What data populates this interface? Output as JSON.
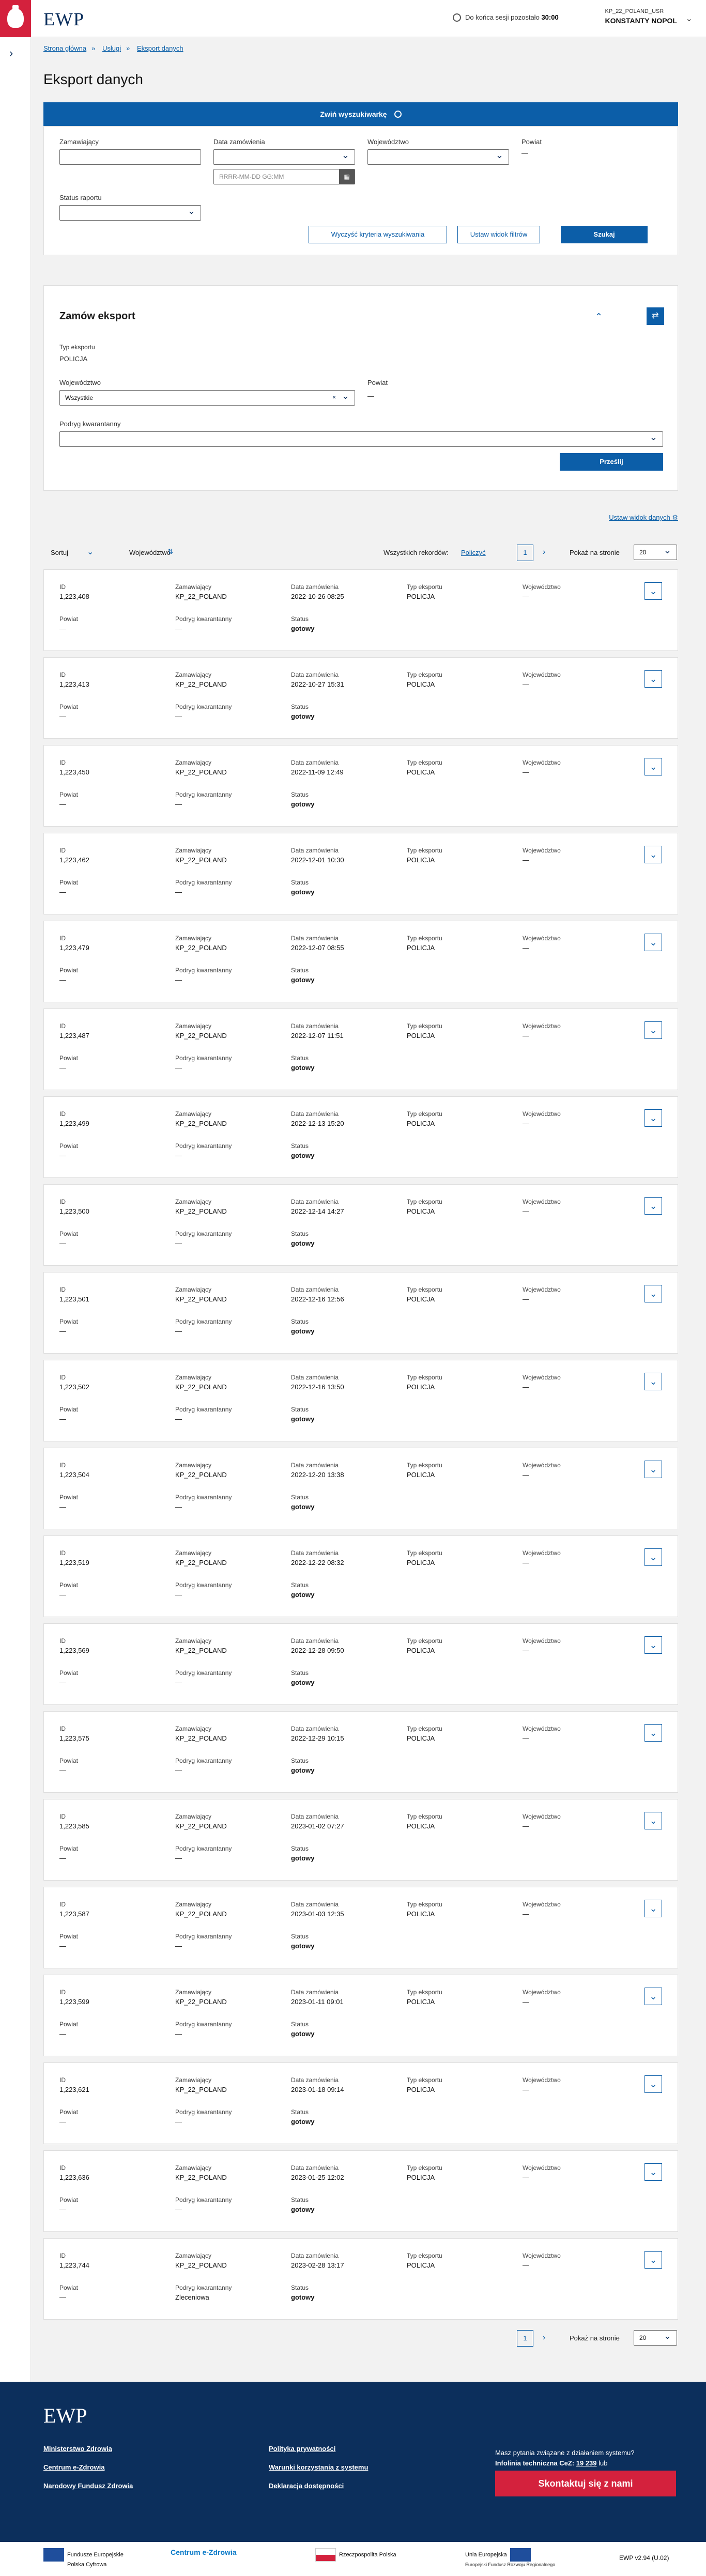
{
  "header": {
    "brand": "EWP",
    "session_text": "Do końca sesji pozostało",
    "session_time": "30:00",
    "user_id": "KP_22_POLAND_USR",
    "user_name": "KONSTANTY NOPOL"
  },
  "breadcrumb": [
    "Strona główna",
    "Usługi",
    "Eksport danych"
  ],
  "page_title": "Eksport danych",
  "search": {
    "collapse_label": "Zwiń wyszukiwarkę",
    "f_zam": "Zamawiający",
    "f_data": "Data zamówienia",
    "date_ph": "RRRR-MM-DD GG:MM",
    "f_woj": "Województwo",
    "f_powiat": "Powiat",
    "powiat_val": "—",
    "f_status": "Status raportu",
    "btn_clear": "Wyczyść kryteria wyszukiwania",
    "btn_filter": "Ustaw widok filtrów",
    "btn_search": "Szukaj"
  },
  "order": {
    "title": "Zamów eksport",
    "type_lbl": "Typ eksportu",
    "type_val": "POLICJA",
    "woj_lbl": "Województwo",
    "woj_val": "Wszystkie",
    "powiat_lbl": "Powiat",
    "powiat_val": "—",
    "podryg_lbl": "Podryg kwarantanny",
    "btn": "Prześlij"
  },
  "list": {
    "view_link": "Ustaw widok danych",
    "sort": "Sortuj",
    "sort_field": "Województwo",
    "total_lbl": "Wszystkich rekordów:",
    "total_link": "Policzyć",
    "page": "1",
    "per_page_lbl": "Pokaż na stronie",
    "per_page": "20",
    "labels": {
      "id": "ID",
      "zam": "Zamawiający",
      "data": "Data zamówienia",
      "typ": "Typ eksportu",
      "woj": "Województwo",
      "powiat": "Powiat",
      "podryg": "Podryg kwarantanny",
      "status": "Status"
    },
    "records": [
      {
        "id": "1,223,408",
        "zam": "KP_22_POLAND",
        "data": "2022-10-26 08:25",
        "typ": "POLICJA",
        "woj": "—",
        "powiat": "—",
        "podryg": "—",
        "status": "gotowy"
      },
      {
        "id": "1,223,413",
        "zam": "KP_22_POLAND",
        "data": "2022-10-27 15:31",
        "typ": "POLICJA",
        "woj": "—",
        "powiat": "—",
        "podryg": "—",
        "status": "gotowy"
      },
      {
        "id": "1,223,450",
        "zam": "KP_22_POLAND",
        "data": "2022-11-09 12:49",
        "typ": "POLICJA",
        "woj": "—",
        "powiat": "—",
        "podryg": "—",
        "status": "gotowy"
      },
      {
        "id": "1,223,462",
        "zam": "KP_22_POLAND",
        "data": "2022-12-01 10:30",
        "typ": "POLICJA",
        "woj": "—",
        "powiat": "—",
        "podryg": "—",
        "status": "gotowy"
      },
      {
        "id": "1,223,479",
        "zam": "KP_22_POLAND",
        "data": "2022-12-07 08:55",
        "typ": "POLICJA",
        "woj": "—",
        "powiat": "—",
        "podryg": "—",
        "status": "gotowy"
      },
      {
        "id": "1,223,487",
        "zam": "KP_22_POLAND",
        "data": "2022-12-07 11:51",
        "typ": "POLICJA",
        "woj": "—",
        "powiat": "—",
        "podryg": "—",
        "status": "gotowy"
      },
      {
        "id": "1,223,499",
        "zam": "KP_22_POLAND",
        "data": "2022-12-13 15:20",
        "typ": "POLICJA",
        "woj": "—",
        "powiat": "—",
        "podryg": "—",
        "status": "gotowy"
      },
      {
        "id": "1,223,500",
        "zam": "KP_22_POLAND",
        "data": "2022-12-14 14:27",
        "typ": "POLICJA",
        "woj": "—",
        "powiat": "—",
        "podryg": "—",
        "status": "gotowy"
      },
      {
        "id": "1,223,501",
        "zam": "KP_22_POLAND",
        "data": "2022-12-16 12:56",
        "typ": "POLICJA",
        "woj": "—",
        "powiat": "—",
        "podryg": "—",
        "status": "gotowy"
      },
      {
        "id": "1,223,502",
        "zam": "KP_22_POLAND",
        "data": "2022-12-16 13:50",
        "typ": "POLICJA",
        "woj": "—",
        "powiat": "—",
        "podryg": "—",
        "status": "gotowy"
      },
      {
        "id": "1,223,504",
        "zam": "KP_22_POLAND",
        "data": "2022-12-20 13:38",
        "typ": "POLICJA",
        "woj": "—",
        "powiat": "—",
        "podryg": "—",
        "status": "gotowy"
      },
      {
        "id": "1,223,519",
        "zam": "KP_22_POLAND",
        "data": "2022-12-22 08:32",
        "typ": "POLICJA",
        "woj": "—",
        "powiat": "—",
        "podryg": "—",
        "status": "gotowy"
      },
      {
        "id": "1,223,569",
        "zam": "KP_22_POLAND",
        "data": "2022-12-28 09:50",
        "typ": "POLICJA",
        "woj": "—",
        "powiat": "—",
        "podryg": "—",
        "status": "gotowy"
      },
      {
        "id": "1,223,575",
        "zam": "KP_22_POLAND",
        "data": "2022-12-29 10:15",
        "typ": "POLICJA",
        "woj": "—",
        "powiat": "—",
        "podryg": "—",
        "status": "gotowy"
      },
      {
        "id": "1,223,585",
        "zam": "KP_22_POLAND",
        "data": "2023-01-02 07:27",
        "typ": "POLICJA",
        "woj": "—",
        "powiat": "—",
        "podryg": "—",
        "status": "gotowy"
      },
      {
        "id": "1,223,587",
        "zam": "KP_22_POLAND",
        "data": "2023-01-03 12:35",
        "typ": "POLICJA",
        "woj": "—",
        "powiat": "—",
        "podryg": "—",
        "status": "gotowy"
      },
      {
        "id": "1,223,599",
        "zam": "KP_22_POLAND",
        "data": "2023-01-11 09:01",
        "typ": "POLICJA",
        "woj": "—",
        "powiat": "—",
        "podryg": "—",
        "status": "gotowy"
      },
      {
        "id": "1,223,621",
        "zam": "KP_22_POLAND",
        "data": "2023-01-18 09:14",
        "typ": "POLICJA",
        "woj": "—",
        "powiat": "—",
        "podryg": "—",
        "status": "gotowy"
      },
      {
        "id": "1,223,636",
        "zam": "KP_22_POLAND",
        "data": "2023-01-25 12:02",
        "typ": "POLICJA",
        "woj": "—",
        "powiat": "—",
        "podryg": "—",
        "status": "gotowy"
      },
      {
        "id": "1,223,744",
        "zam": "KP_22_POLAND",
        "data": "2023-02-28 13:17",
        "typ": "POLICJA",
        "woj": "—",
        "powiat": "—",
        "podryg": "Zleceniowa",
        "status": "gotowy"
      }
    ]
  },
  "footer": {
    "brand": "EWP",
    "links_left": [
      "Ministerstwo Zdrowia",
      "Centrum e-Zdrowia",
      "Narodowy Fundusz Zdrowia"
    ],
    "links_mid": [
      "Polityka prywatności",
      "Warunki korzystania z systemu",
      "Deklaracja dostępności"
    ],
    "question": "Masz pytania związane z działaniem systemu?",
    "infoline": "Infolinia techniczna CeZ:",
    "phone": "19 239",
    "phone_suffix": "lub",
    "contact_btn": "Skontaktuj się z nami"
  },
  "logos": {
    "fe": "Fundusze Europejskie",
    "fe_sub": "Polska Cyfrowa",
    "cez": "Centrum e-Zdrowia",
    "rp": "Rzeczpospolita Polska",
    "ue": "Unia Europejska",
    "ue_sub": "Europejski Fundusz Rozwoju Regionalnego",
    "version": "EWP v2.94 (U.02)"
  }
}
